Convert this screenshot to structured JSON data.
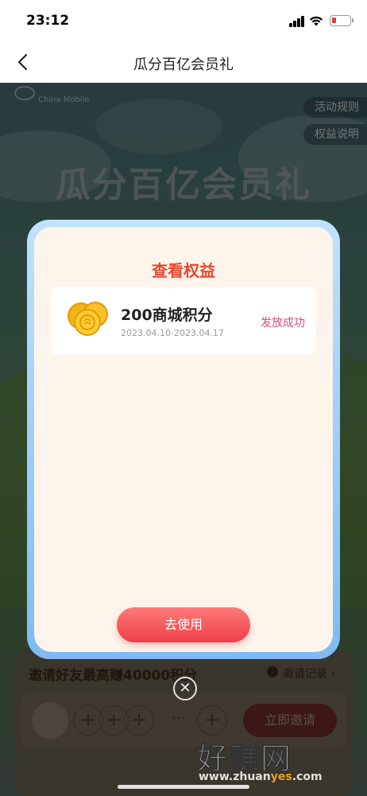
{
  "status_bar": {
    "time": "23:12"
  },
  "nav": {
    "title": "瓜分百亿会员礼"
  },
  "background": {
    "logo_text": "China Mobile",
    "rules_label": "活动规则",
    "benefits_desc_label": "权益说明",
    "banner_title": "瓜分百亿会员礼",
    "invite": {
      "title": "邀请好友最高赚40000积分",
      "record_label": "邀请记录 ›",
      "plus": "+",
      "ellipsis": "···",
      "invite_button": "立即邀请"
    }
  },
  "modal": {
    "title": "查看权益",
    "benefit": {
      "name": "200商城积分",
      "date_range": "2023.04.10-2023.04.17",
      "status": "发放成功"
    },
    "use_button": "去使用"
  },
  "close_label": "✕",
  "watermark": {
    "text": "好赚网",
    "url_pre": "www.zhuan",
    "url_hi": "yes",
    "url_post": ".com"
  },
  "colors": {
    "accent_red": "#e8482f",
    "status_pink": "#e8457b",
    "button_red": "#ee3f4a",
    "modal_border": "#7fbaf1"
  }
}
